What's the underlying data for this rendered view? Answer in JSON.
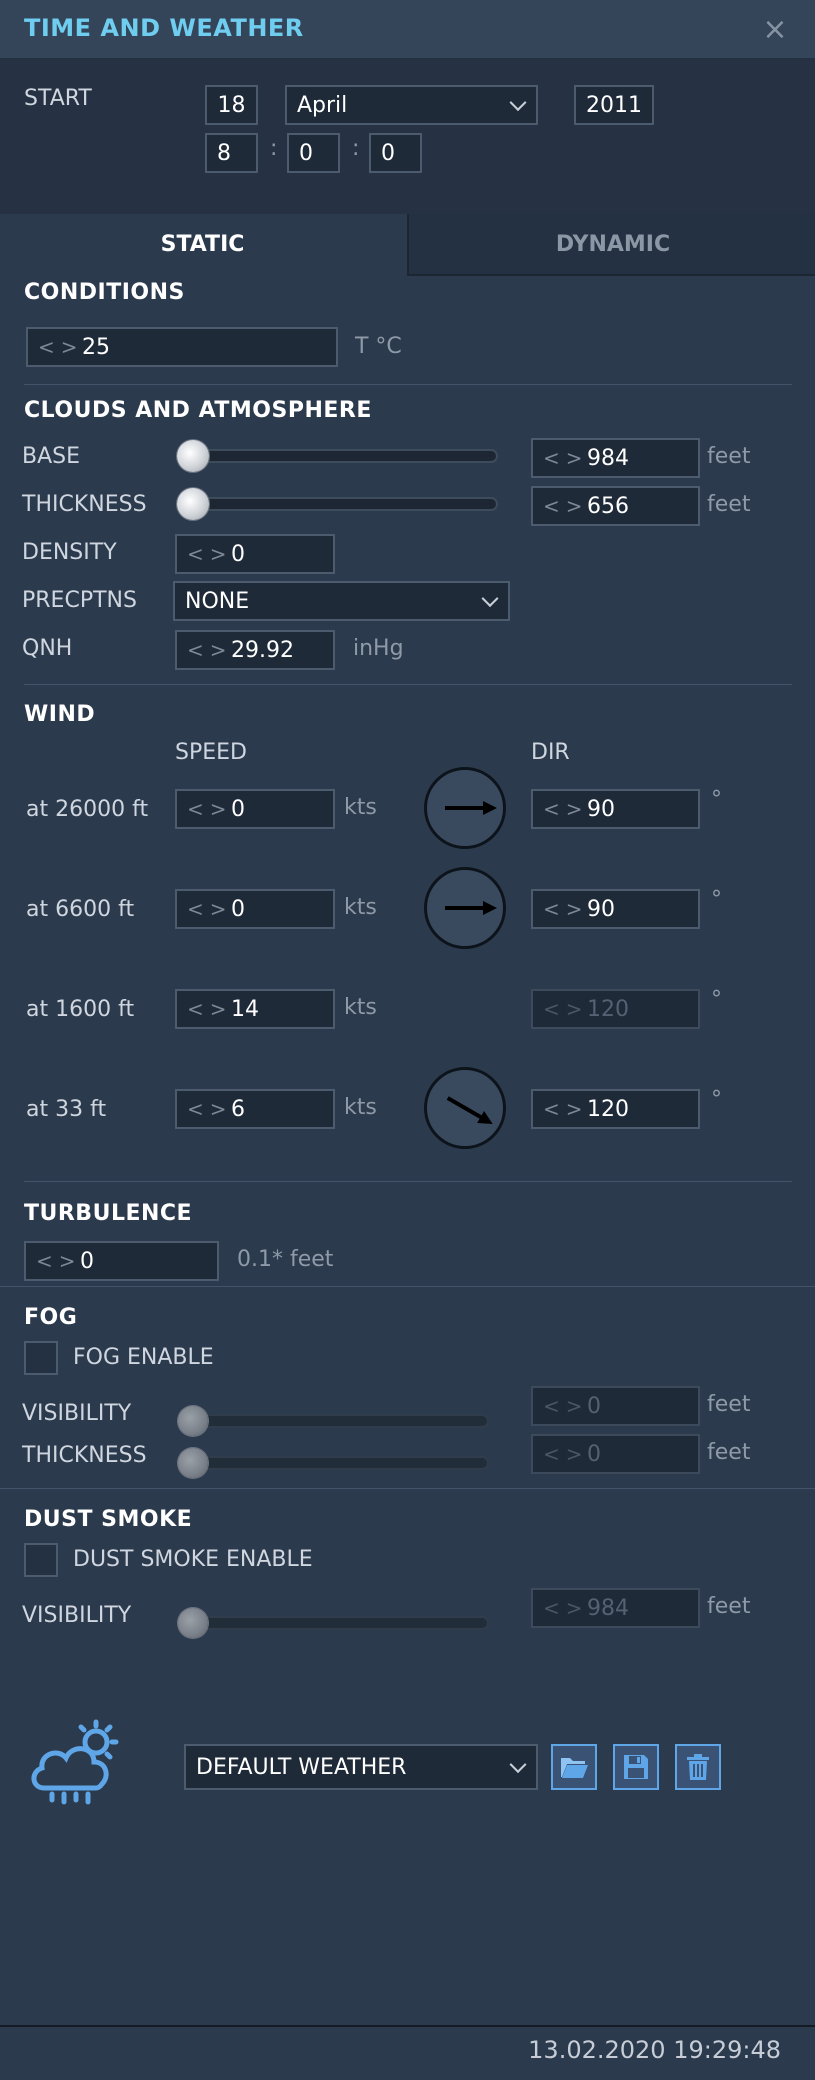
{
  "window": {
    "title": "TIME AND WEATHER",
    "close_symbol": "×"
  },
  "start": {
    "label": "START",
    "day": "18",
    "month": "April",
    "year": "2011",
    "hour": "8",
    "minute": "0",
    "second": "0",
    "separator": ":"
  },
  "tabs": [
    {
      "label": "STATIC",
      "active": true
    },
    {
      "label": "DYNAMIC",
      "active": false
    }
  ],
  "conditions": {
    "title": "CONDITIONS",
    "temperature": "25",
    "temperature_unit": "T °C"
  },
  "clouds": {
    "title": "CLOUDS AND ATMOSPHERE",
    "base": {
      "label": "BASE",
      "value": "984",
      "unit": "feet",
      "slider_level": 0
    },
    "thickness": {
      "label": "THICKNESS",
      "value": "656",
      "unit": "feet",
      "slider_level": 0
    },
    "density": {
      "label": "DENSITY",
      "value": "0"
    },
    "precipitation": {
      "label": "PRECPTNS",
      "value": "NONE"
    },
    "qnh": {
      "label": "QNH",
      "value": "29.92",
      "unit": "inHg"
    }
  },
  "wind": {
    "title": "WIND",
    "speed_header": "SPEED",
    "dir_header": "DIR",
    "rows": [
      {
        "altitude": "at 26000 ft",
        "speed": "0",
        "speed_unit": "kts",
        "dir": "90",
        "dir_unit": "°",
        "dial_visible": true,
        "dir_enabled": true
      },
      {
        "altitude": "at 6600 ft",
        "speed": "0",
        "speed_unit": "kts",
        "dir": "90",
        "dir_unit": "°",
        "dial_visible": true,
        "dir_enabled": true
      },
      {
        "altitude": "at 1600 ft",
        "speed": "14",
        "speed_unit": "kts",
        "dir": "120",
        "dir_unit": "°",
        "dial_visible": false,
        "dir_enabled": false
      },
      {
        "altitude": "at 33 ft",
        "speed": "6",
        "speed_unit": "kts",
        "dir": "120",
        "dir_unit": "°",
        "dial_visible": true,
        "dir_enabled": true
      }
    ]
  },
  "turbulence": {
    "title": "TURBULENCE",
    "value": "0",
    "unit": "0.1* feet"
  },
  "fog": {
    "title": "FOG",
    "enable_label": "FOG ENABLE",
    "enabled": false,
    "visibility": {
      "label": "VISIBILITY",
      "value": "0",
      "unit": "feet",
      "slider_level": 0
    },
    "thickness": {
      "label": "THICKNESS",
      "value": "0",
      "unit": "feet",
      "slider_level": 0
    }
  },
  "dust_smoke": {
    "title": "DUST SMOKE",
    "enable_label": "DUST SMOKE ENABLE",
    "enabled": false,
    "visibility": {
      "label": "VISIBILITY",
      "value": "984",
      "unit": "feet",
      "slider_level": 0
    }
  },
  "preset": {
    "value": "DEFAULT WEATHER",
    "icons": [
      "weather-cloud-sun-rain-icon",
      "open-folder-icon",
      "save-floppy-icon",
      "delete-trash-icon"
    ]
  },
  "footer": {
    "datetime": "13.02.2020 19:29:48"
  },
  "colors": {
    "accent_title": "#6fcdf0",
    "background": "#2c3a4d",
    "icon_blue": "#5ea6e8"
  }
}
